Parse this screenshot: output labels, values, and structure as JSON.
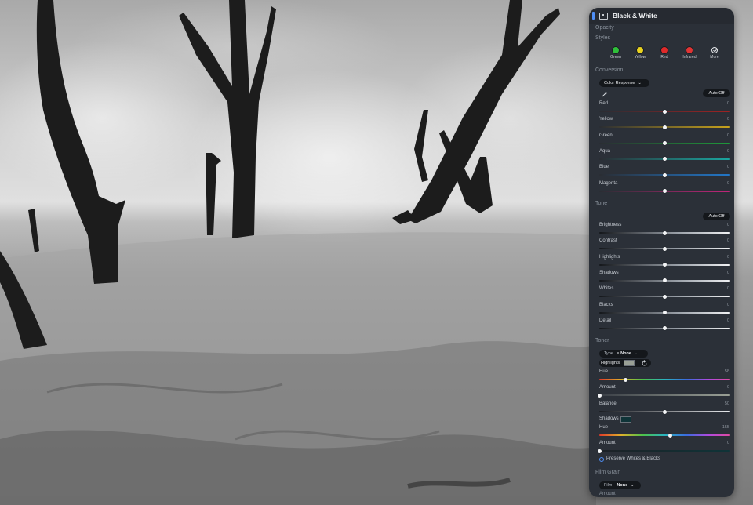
{
  "panel": {
    "title": "Black & White",
    "opacity_label": "Opacity",
    "styles_label": "Styles",
    "styles": [
      {
        "label": "Green",
        "color": "#2fbf3a"
      },
      {
        "label": "Yellow",
        "color": "#e9d21f"
      },
      {
        "label": "Red",
        "color": "#e02a2a"
      },
      {
        "label": "Infrared",
        "color": "#e03434"
      },
      {
        "label": "More",
        "icon": "checkmark-circle-icon"
      }
    ],
    "conversion": {
      "label": "Conversion",
      "dropdown": "Color Response",
      "auto_button": "Auto Off",
      "sliders": [
        {
          "label": "Red",
          "value": "0",
          "level": 0.5,
          "gradient": [
            "#2a2d33",
            "#a02222"
          ]
        },
        {
          "label": "Yellow",
          "value": "0",
          "level": 0.5,
          "gradient": [
            "#2a2d33",
            "#c7a21c"
          ]
        },
        {
          "label": "Green",
          "value": "0",
          "level": 0.5,
          "gradient": [
            "#2a2d33",
            "#1e9a3a"
          ]
        },
        {
          "label": "Aqua",
          "value": "0",
          "level": 0.5,
          "gradient": [
            "#2a2d33",
            "#1aa6a0"
          ]
        },
        {
          "label": "Blue",
          "value": "0",
          "level": 0.5,
          "gradient": [
            "#2a2d33",
            "#2277c9"
          ]
        },
        {
          "label": "Magenta",
          "value": "0",
          "level": 0.5,
          "gradient": [
            "#2a2d33",
            "#c2257a"
          ]
        }
      ]
    },
    "tone": {
      "label": "Tone",
      "auto_button": "Auto Off",
      "sliders": [
        {
          "label": "Brightness",
          "value": "0",
          "level": 0.5
        },
        {
          "label": "Contrast",
          "value": "0",
          "level": 0.5
        },
        {
          "label": "Highlights",
          "value": "0",
          "level": 0.5
        },
        {
          "label": "Shadows",
          "value": "0",
          "level": 0.5
        },
        {
          "label": "Whites",
          "value": "0",
          "level": 0.5
        },
        {
          "label": "Blacks",
          "value": "0",
          "level": 0.5
        },
        {
          "label": "Detail",
          "value": "0",
          "level": 0.5
        }
      ]
    },
    "toner": {
      "label": "Toner",
      "type_label": "Type",
      "type_value": "None",
      "highlights_label": "Highlights",
      "highlights_color": "#9aa096",
      "hue1": {
        "label": "Hue",
        "value": "58",
        "level": 0.2
      },
      "amount1": {
        "label": "Amount",
        "value": "0",
        "level": 0.0
      },
      "balance": {
        "label": "Balance",
        "value": "50",
        "level": 0.5
      },
      "shadows_label": "Shadows",
      "shadows_color": "#0f3438",
      "hue2": {
        "label": "Hue",
        "value": "155",
        "level": 0.54
      },
      "amount2": {
        "label": "Amount",
        "value": "0",
        "level": 0.0
      },
      "preserve_label": "Preserve Whites & Blacks"
    },
    "film_grain": {
      "label": "Film Grain",
      "film_label": "Film",
      "film_value": "None",
      "amount_label": "Amount"
    }
  }
}
